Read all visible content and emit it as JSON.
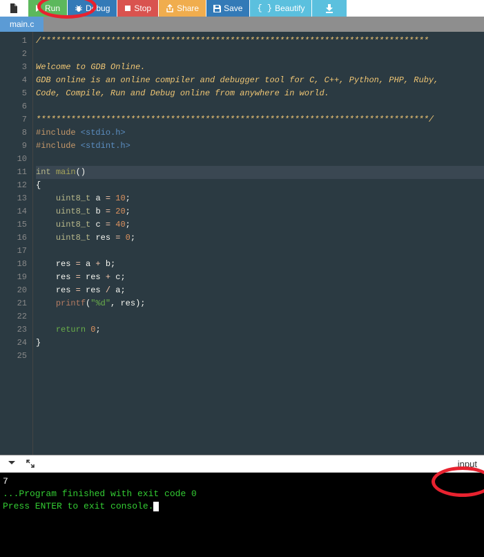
{
  "toolbar": {
    "run_label": "Run",
    "debug_label": "Debug",
    "stop_label": "Stop",
    "share_label": "Share",
    "save_label": "Save",
    "beautify_label": "Beautify"
  },
  "tabs": [
    {
      "label": "main.c"
    }
  ],
  "gutter_lines": [
    "1",
    "2",
    "3",
    "4",
    "5",
    "6",
    "7",
    "8",
    "9",
    "10",
    "11",
    "12",
    "13",
    "14",
    "15",
    "16",
    "17",
    "18",
    "19",
    "20",
    "21",
    "22",
    "23",
    "24",
    "25"
  ],
  "code": {
    "l1": "/******************************************************************************",
    "l2": "",
    "l3": "Welcome to GDB Online.",
    "l4": "GDB online is an online compiler and debugger tool for C, C++, Python, PHP, Ruby,",
    "l5": "Code, Compile, Run and Debug online from anywhere in world.",
    "l6": "",
    "l7": "*******************************************************************************/",
    "include_kw": "#include",
    "inc1": " <stdio.h>",
    "inc2": " <stdint.h>",
    "int_kw": "int",
    "main_kw": "main",
    "parens": "()",
    "lbrace": "{",
    "rbrace": "}",
    "uint8t": "uint8_t",
    "var_a": "a",
    "var_b": "b",
    "var_c": "c",
    "var_res": "res",
    "eq": " = ",
    "semi": ";",
    "n10": "10",
    "n20": "20",
    "n40": "40",
    "n0": "0",
    "plus": " + ",
    "div": " / ",
    "printf": "printf",
    "fmt": "\"%d\"",
    "comma": ", ",
    "lp": "(",
    "rp": ")",
    "return_kw": "return"
  },
  "console": {
    "output": "7",
    "finished": "...Program finished with exit code 0",
    "press_enter": "Press ENTER to exit console."
  },
  "input_label": "input"
}
